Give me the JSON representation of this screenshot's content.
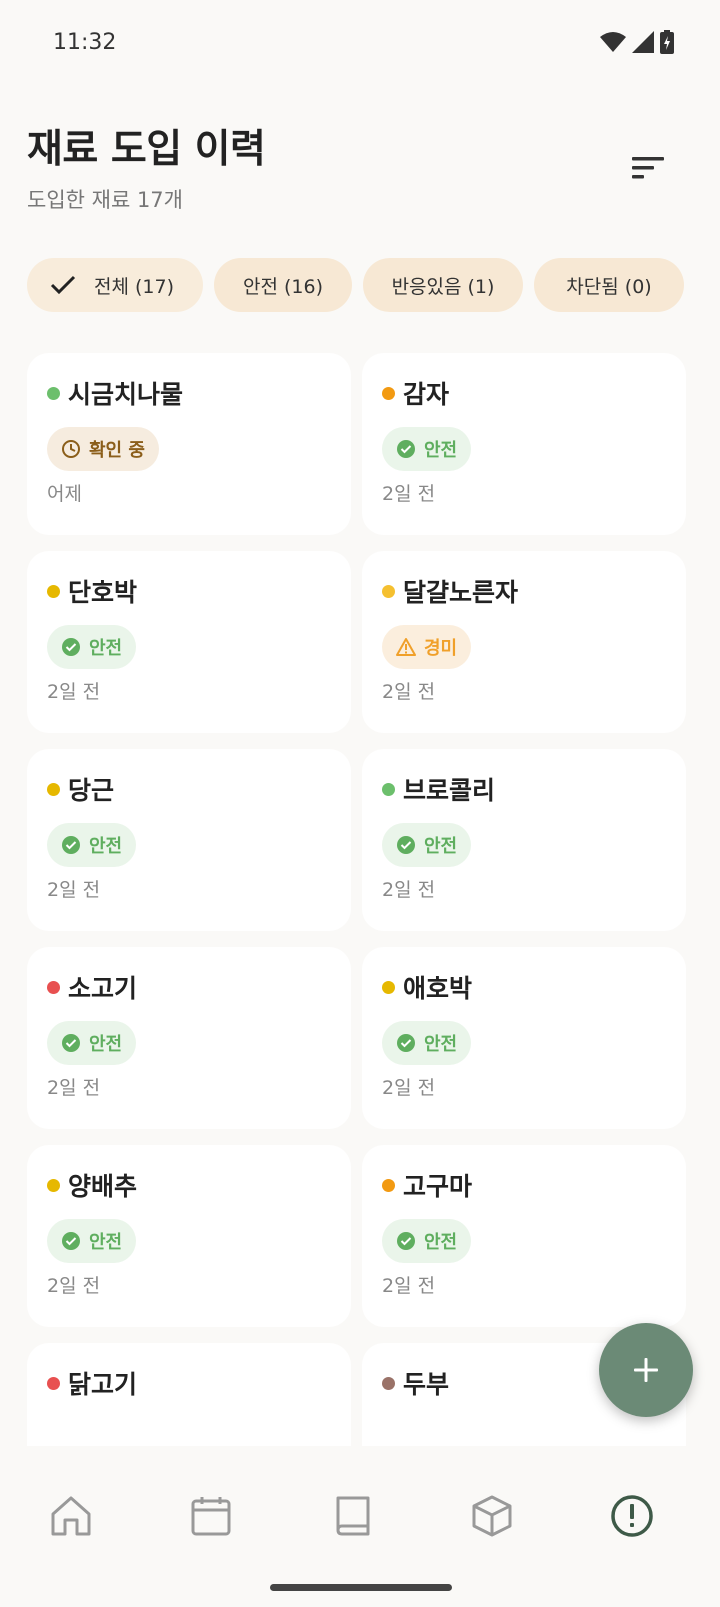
{
  "status_bar": {
    "time": "11:32"
  },
  "header": {
    "title": "재료 도입 이력",
    "subtitle": "도입한 재료 17개"
  },
  "filters": [
    {
      "label": "전체 (17)",
      "selected": true
    },
    {
      "label": "안전 (16)",
      "selected": false
    },
    {
      "label": "반응있음 (1)",
      "selected": false
    },
    {
      "label": "차단됨 (0)",
      "selected": false
    }
  ],
  "colors": {
    "accent": "#6b8a76",
    "safe": "#5fae5f",
    "pending": "#8b5e1a",
    "mild": "#f0a02a",
    "chip_bg": "#f7e8d4"
  },
  "ingredients": [
    {
      "name": "시금치나물",
      "dot_color": "#6cbf6c",
      "status": "확인 중",
      "status_type": "pending",
      "date": "어제"
    },
    {
      "name": "감자",
      "dot_color": "#f29a12",
      "status": "안전",
      "status_type": "safe",
      "date": "2일 전"
    },
    {
      "name": "단호박",
      "dot_color": "#e6b800",
      "status": "안전",
      "status_type": "safe",
      "date": "2일 전"
    },
    {
      "name": "달걀노른자",
      "dot_color": "#f5c030",
      "status": "경미",
      "status_type": "mild",
      "date": "2일 전"
    },
    {
      "name": "당근",
      "dot_color": "#e6b800",
      "status": "안전",
      "status_type": "safe",
      "date": "2일 전"
    },
    {
      "name": "브로콜리",
      "dot_color": "#6cbf6c",
      "status": "안전",
      "status_type": "safe",
      "date": "2일 전"
    },
    {
      "name": "소고기",
      "dot_color": "#e85050",
      "status": "안전",
      "status_type": "safe",
      "date": "2일 전"
    },
    {
      "name": "애호박",
      "dot_color": "#e6b800",
      "status": "안전",
      "status_type": "safe",
      "date": "2일 전"
    },
    {
      "name": "양배추",
      "dot_color": "#e6b800",
      "status": "안전",
      "status_type": "safe",
      "date": "2일 전"
    },
    {
      "name": "고구마",
      "dot_color": "#f29a12",
      "status": "안전",
      "status_type": "safe",
      "date": "2일 전"
    },
    {
      "name": "닭고기",
      "dot_color": "#e85050",
      "status": "",
      "status_type": "safe",
      "date": ""
    },
    {
      "name": "두부",
      "dot_color": "#9a7268",
      "status": "",
      "status_type": "safe",
      "date": ""
    }
  ],
  "nav": [
    {
      "icon": "home-icon",
      "active": false
    },
    {
      "icon": "calendar-icon",
      "active": false
    },
    {
      "icon": "book-icon",
      "active": false
    },
    {
      "icon": "box-icon",
      "active": false
    },
    {
      "icon": "alert-icon",
      "active": true
    }
  ]
}
